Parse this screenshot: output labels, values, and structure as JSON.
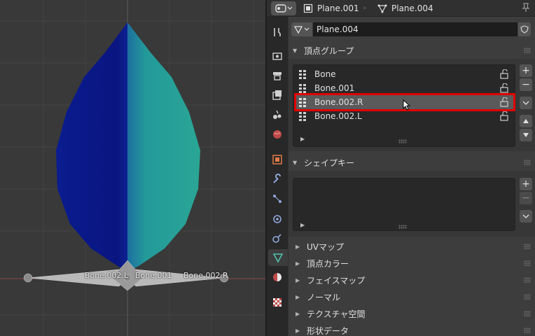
{
  "header": {
    "object_name": "Plane.001",
    "data_name": "Plane.004"
  },
  "mesh_datablock": {
    "name": "Plane.004"
  },
  "viewport": {
    "bones": [
      "Bone.002.L",
      "Bone.001",
      "Bone.002.R"
    ]
  },
  "vertex_groups": {
    "title": "頂点グループ",
    "items": [
      {
        "label": "Bone",
        "selected": false
      },
      {
        "label": "Bone.001",
        "selected": false
      },
      {
        "label": "Bone.002.R",
        "selected": true
      },
      {
        "label": "Bone.002.L",
        "selected": false
      }
    ]
  },
  "shape_keys": {
    "title": "シェイプキー"
  },
  "collapsed_panels": [
    "UVマップ",
    "頂点カラー",
    "フェイスマップ",
    "ノーマル",
    "テクスチャ空間",
    "形状データ"
  ],
  "colors": {
    "highlight_outline": "#e00000",
    "active_tab_icon": "#4fc3b0",
    "leaf_dark": "#0a1a8c",
    "leaf_light": "#2aa89a"
  }
}
